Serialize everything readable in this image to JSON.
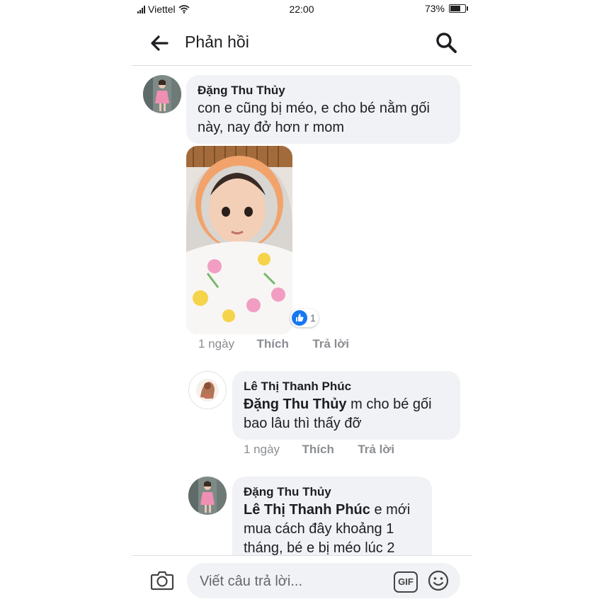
{
  "status_bar": {
    "carrier": "Viettel",
    "time": "22:00",
    "battery": "73%",
    "battery_level": 0.73
  },
  "header": {
    "title": "Phản hồi",
    "back_icon": "arrow-left-icon",
    "search_icon": "search-icon"
  },
  "comments": [
    {
      "author": "Đặng Thu Thủy",
      "text": "con e cũng bị méo, e cho bé nằm gối này, nay đở hơn r mom",
      "has_photo": true,
      "reaction": {
        "icon": "like-icon",
        "count": "1"
      },
      "time": "1 ngày",
      "like_label": "Thích",
      "reply_label": "Trả lời"
    },
    {
      "author": "Lê Thị Thanh Phúc",
      "mention": "Đặng Thu Thủy",
      "text": " m cho bé gối bao lâu thì thấy đỡ",
      "time": "1 ngày",
      "like_label": "Thích",
      "reply_label": "Trả lời"
    },
    {
      "author": "Đặng Thu Thủy",
      "mention": "Lê Thị Thanh Phúc",
      "text": " e mới mua cách đây khoảng 1 tháng, bé e bị méo lúc 2"
    }
  ],
  "composer": {
    "placeholder": "Viết câu trả lời...",
    "camera_icon": "camera-icon",
    "gif_label": "GIF",
    "emoji_icon": "smiley-icon"
  }
}
